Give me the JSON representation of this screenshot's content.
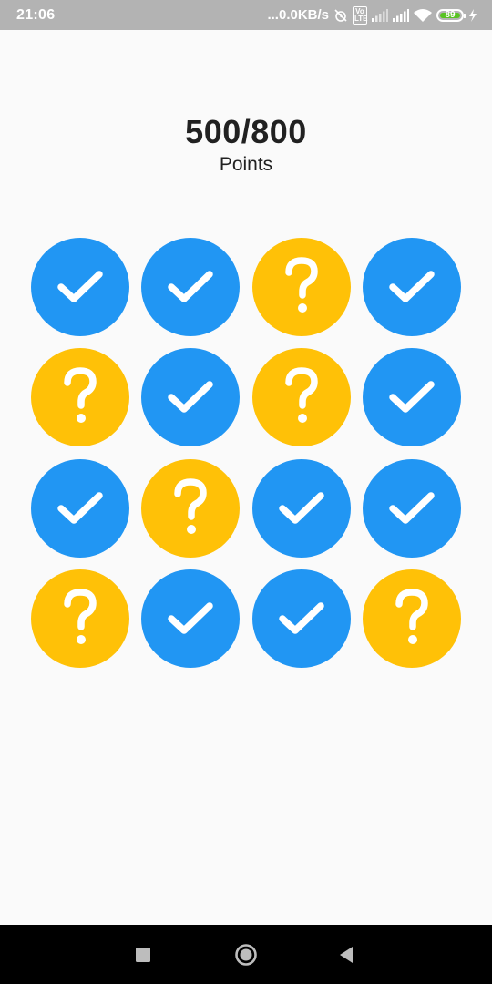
{
  "status_bar": {
    "time": "21:06",
    "network_speed": "...0.0KB/s",
    "volte_label": "Vo LTE",
    "battery_level": "89",
    "battery_color": "#58c322",
    "icons": [
      "alarm-off-icon",
      "volte-icon",
      "signal-icon",
      "signal-icon",
      "wifi-icon",
      "battery-icon",
      "charging-icon"
    ]
  },
  "score": {
    "value": "500/800",
    "label": "Points"
  },
  "colors": {
    "done": "#2196f3",
    "hidden": "#ffc107",
    "text": "#212121"
  },
  "tiles": [
    "done",
    "done",
    "hidden",
    "done",
    "hidden",
    "done",
    "hidden",
    "done",
    "done",
    "hidden",
    "done",
    "done",
    "hidden",
    "done",
    "done",
    "hidden"
  ],
  "tile_icons": {
    "done": "check-icon",
    "hidden": "question-mark-icon"
  },
  "nav_bar": {
    "buttons": [
      "recents-square-icon",
      "home-circle-icon",
      "back-triangle-icon"
    ]
  }
}
